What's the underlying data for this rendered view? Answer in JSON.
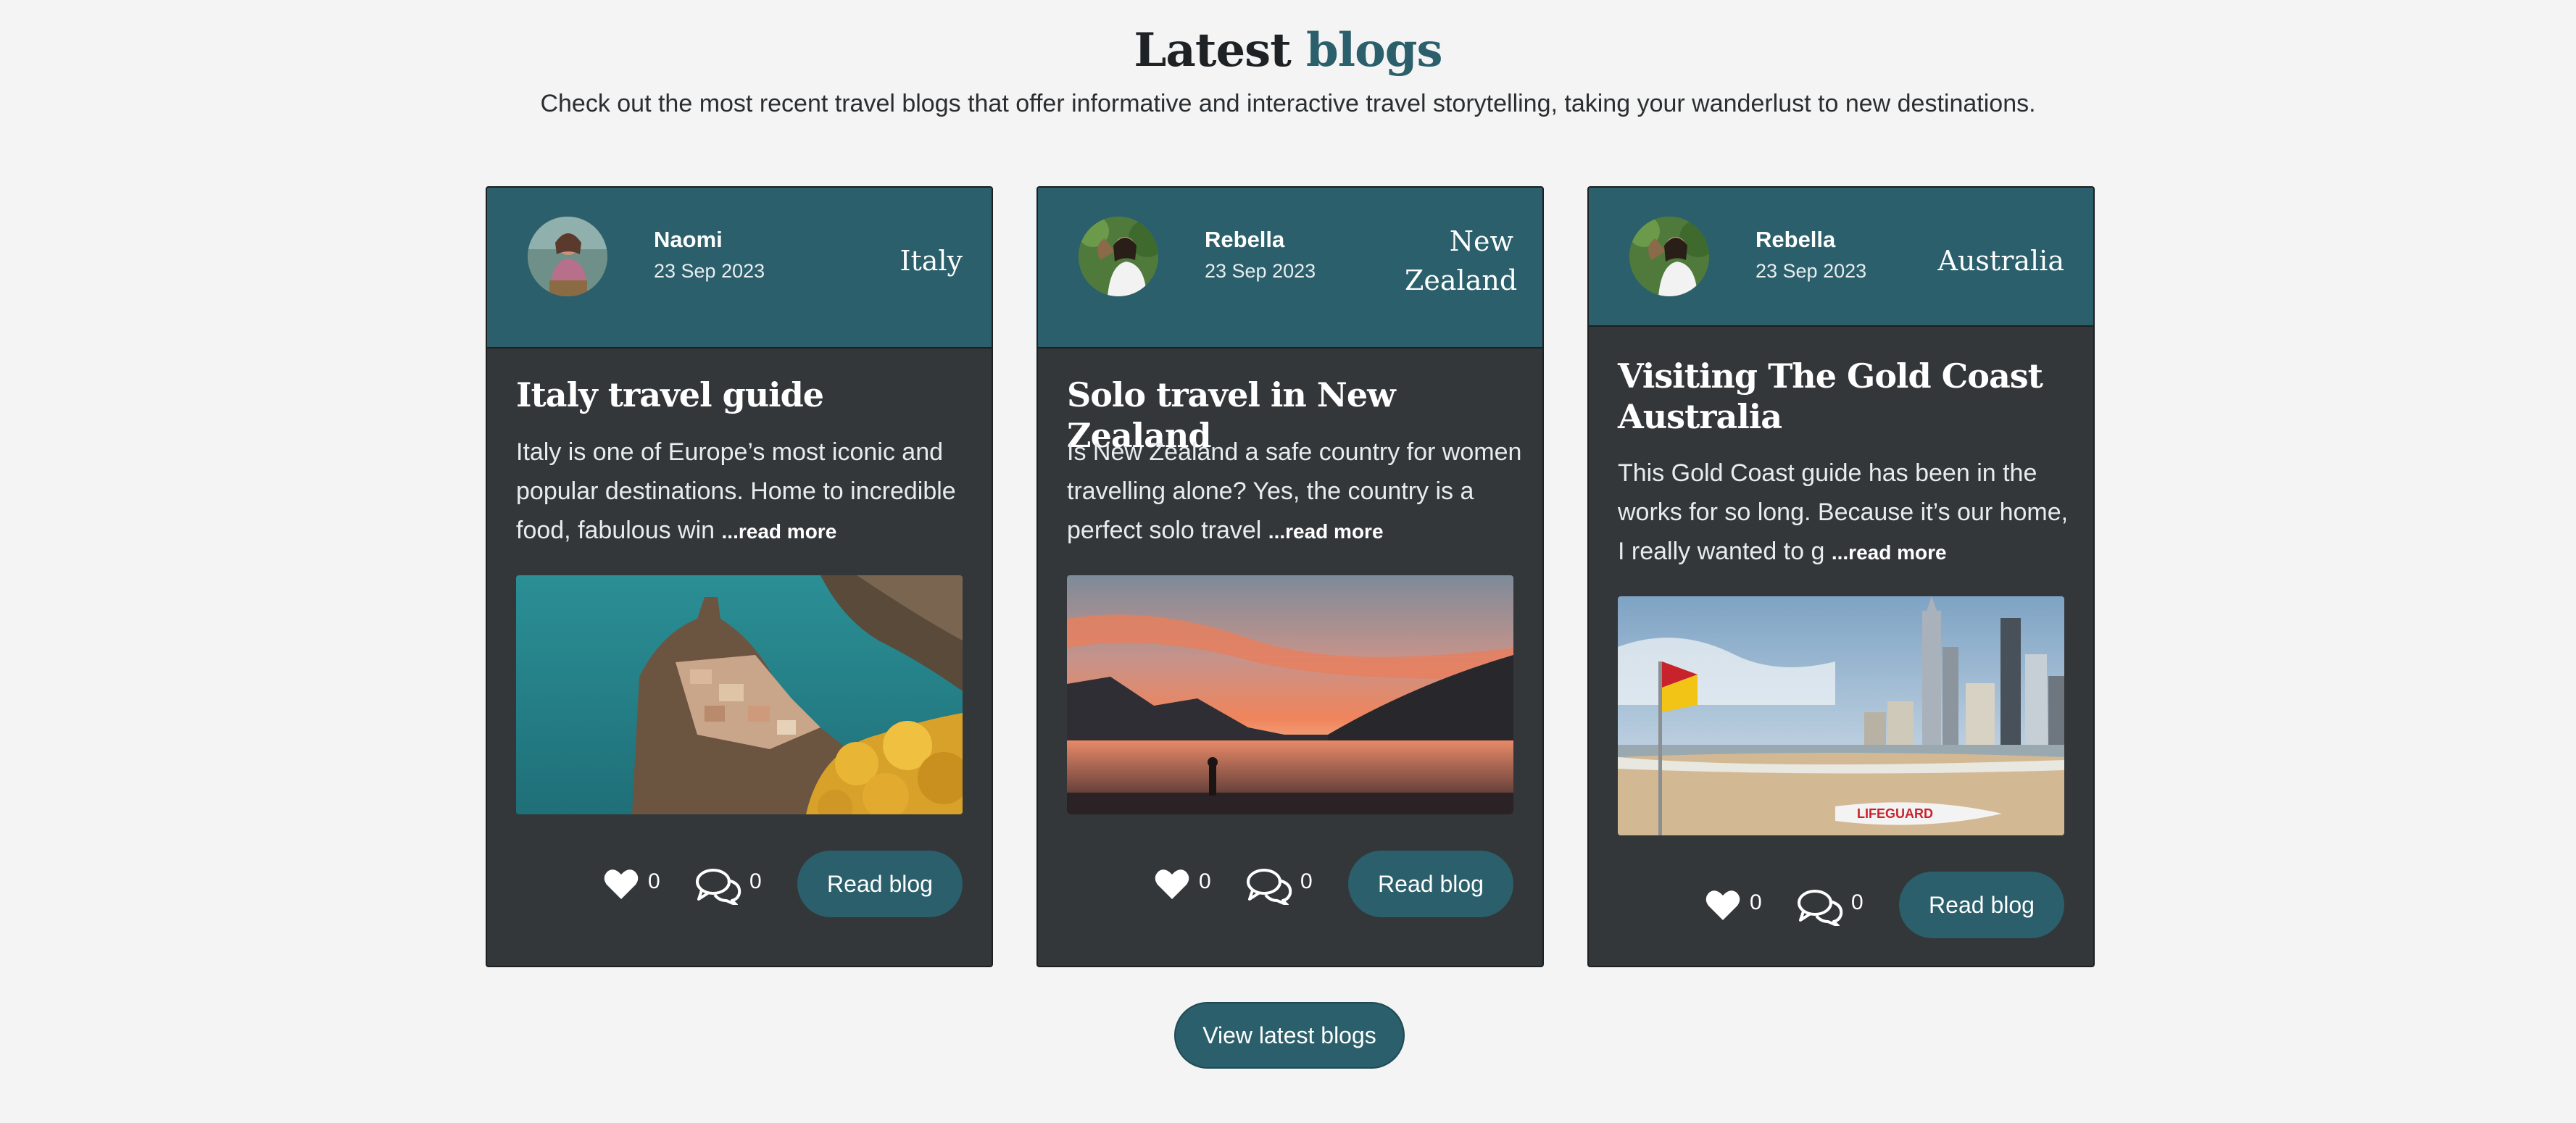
{
  "section": {
    "title_main": "Latest",
    "title_accent": "blogs",
    "subtitle": "Check out the most recent travel blogs that offer informative and interactive travel storytelling, taking your wanderlust to new destinations."
  },
  "cards": [
    {
      "author": "Naomi",
      "date": "23 Sep 2023",
      "location": "Italy",
      "title": "Italy travel guide",
      "excerpt": "Italy is one of Europe’s most iconic and popular destinations. Home to incredible food, fabulous win",
      "read_more": "...read more",
      "likes": "0",
      "comments": "0",
      "button": "Read blog"
    },
    {
      "author": "Rebella",
      "date": "23 Sep 2023",
      "location": "New Zealand",
      "title": "Solo travel in New Zealand",
      "excerpt": "Is New Zealand a safe country for women travelling alone? Yes, the country is a perfect solo travel ",
      "read_more": "...read more",
      "likes": "0",
      "comments": "0",
      "button": "Read blog"
    },
    {
      "author": "Rebella",
      "date": "23 Sep 2023",
      "location": "Australia",
      "title": "Visiting The Gold Coast Australia",
      "excerpt": "This Gold Coast guide has been in the works for so long. Because it’s our home, I really wanted to g",
      "read_more": "...read more",
      "likes": "0",
      "comments": "0",
      "button": "Read blog"
    }
  ],
  "surfboard_text": "LIFEGUARD",
  "footer": {
    "view_button": "View latest blogs"
  },
  "colors": {
    "accent": "#2a5f6b",
    "card_bg": "#33373a",
    "page_bg": "#f4f4f4"
  }
}
